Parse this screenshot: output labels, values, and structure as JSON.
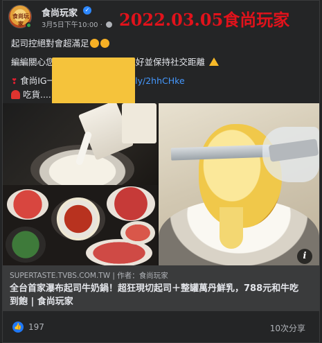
{
  "header": {
    "page_name": "食尚玩家",
    "avatar_text": "食尚玩家",
    "date": "3月5日下午10:00",
    "separator": "·",
    "stamp": "2022.03.05食尚玩家"
  },
  "post": {
    "line1": "起司控",
    "line1b": "絕對會超滿足",
    "line2a": "編編關心您",
    "line2b": "全民防疫 口罩戴好並保持社交距離",
    "line3a": "食尚IG一定要有",
    "line3_link": "http://bit.ly/2hhCHke",
    "line4a": "吃貨...... 顯示更多"
  },
  "link_preview": {
    "domain": "SUPERTASTE.TVBS.COM.TW | 作者：食尚玩家",
    "headline": "全台首家瀑布起司牛奶鍋！超狂現切起司＋整罐萬丹鮮乳，788元和牛吃到飽 | 食尚玩家",
    "info_icon": "i"
  },
  "footer": {
    "reaction_count": "197",
    "share_count": "10次分享"
  },
  "colors": {
    "background": "#242526",
    "text": "#e4e6eb",
    "muted": "#b0b3b8",
    "link": "#4599ff",
    "stamp": "#e1121b",
    "like": "#2078f4"
  }
}
